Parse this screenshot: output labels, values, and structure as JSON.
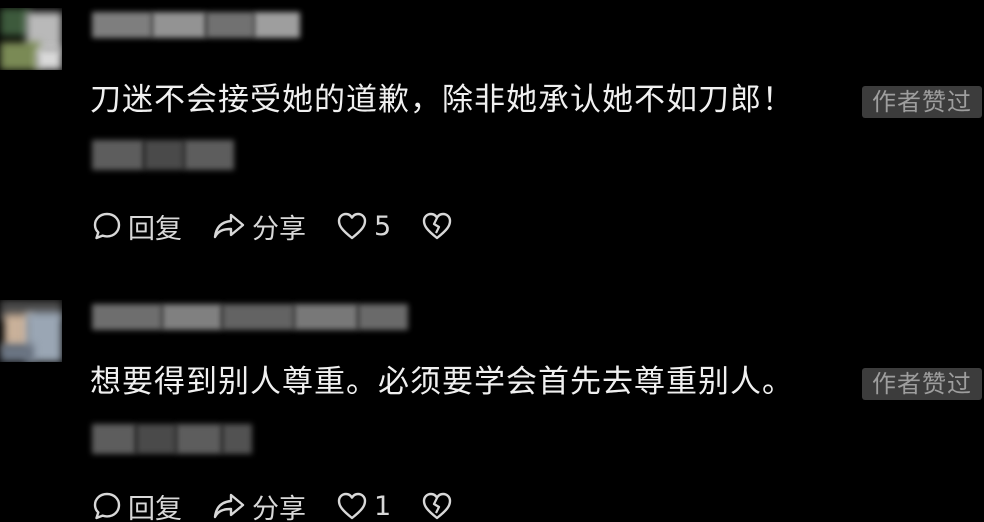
{
  "comments": [
    {
      "text": "刀迷不会接受她的道歉，除非她承认她不如刀郎！",
      "badge": "作者赞过",
      "reply_label": "回复",
      "share_label": "分享",
      "like_count": "5"
    },
    {
      "text": "想要得到别人尊重。必须要学会首先去尊重别人。",
      "badge": "作者赞过",
      "reply_label": "回复",
      "share_label": "分享",
      "like_count": "1"
    }
  ],
  "colors": {
    "background": "#000000",
    "text": "#f0f0f0",
    "badge_bg": "#3c3c3c",
    "badge_text": "#9e9e9e",
    "action": "#d8d8d8"
  },
  "icons": [
    "reply-bubble-icon",
    "share-arrow-icon",
    "heart-icon",
    "broken-heart-icon"
  ]
}
